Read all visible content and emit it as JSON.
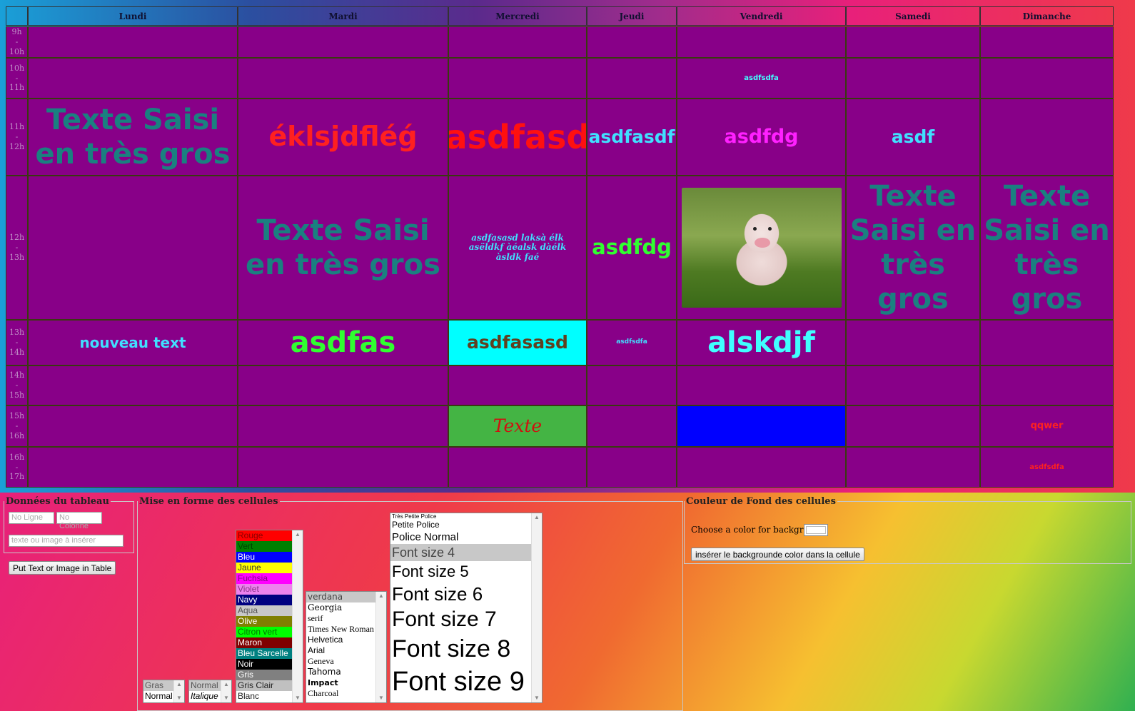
{
  "days": [
    "Lundi",
    "Mardi",
    "Mercredi",
    "Jeudi",
    "Vendredi",
    "Samedi",
    "Dimanche"
  ],
  "times": [
    [
      "9h",
      "-",
      "10h"
    ],
    [
      "10h",
      "-",
      "11h"
    ],
    [
      "11h",
      "-",
      "12h"
    ],
    [
      "12h",
      "-",
      "13h"
    ],
    [
      "13h",
      "-",
      "14h"
    ],
    [
      "14h",
      "-",
      "15h"
    ],
    [
      "15h",
      "-",
      "16h"
    ],
    [
      "16h",
      "-",
      "17h"
    ]
  ],
  "cells": {
    "r1_vendredi": "asdfsdfa",
    "r2_lundi": "Texte Saisi en très gros",
    "r2_mardi": "éklsjdfléǵ",
    "r2_mercredi": "asdfasd",
    "r2_jeudi": "asdfasdf",
    "r2_vendredi": "asdfdg",
    "r2_samedi": "asdf",
    "r3_mardi": "Texte Saisi en très gros",
    "r3_mercredi": "asdfasasd laksà élk asëldkf àéalsk dàélk àsldk faé",
    "r3_jeudi": "asdfdg",
    "r3_samedi": "Texte Saisi en très gros",
    "r3_dimanche": "Texte Saisi en très gros",
    "r4_lundi": "nouveau text",
    "r4_mardi": "asdfas",
    "r4_mercredi": "asdfasasd",
    "r4_jeudi": "asdfsdfa",
    "r4_vendredi": "alskdjf",
    "r6_mercredi": "Texte",
    "r6_dimanche": "qqwer",
    "r7_dimanche": "asdfsdfa"
  },
  "panels": {
    "data": {
      "legend": "Données du tableau",
      "row_placeholder": "No Ligne",
      "col_placeholder": "No Colonne",
      "text_placeholder": "texte ou image à insérer",
      "button": "Put Text or Image in Table"
    },
    "format": {
      "legend": "Mise en forme des cellules",
      "weight_options": [
        "Gras",
        "Normal"
      ],
      "style_options": [
        "Normal",
        "Italique"
      ],
      "colors": [
        {
          "label": "Rouge",
          "bg": "#ff0000",
          "fg": "#880000"
        },
        {
          "label": "Vert",
          "bg": "#008000",
          "fg": "#004400"
        },
        {
          "label": "Bleu",
          "bg": "#0000ff",
          "fg": "#ffffff"
        },
        {
          "label": "Jaune",
          "bg": "#ffff00",
          "fg": "#333333"
        },
        {
          "label": "Fuchsia",
          "bg": "#ff00ff",
          "fg": "#880088"
        },
        {
          "label": "Violet",
          "bg": "#ee82ee",
          "fg": "#883388"
        },
        {
          "label": "Navy",
          "bg": "#000080",
          "fg": "#ffffff"
        },
        {
          "label": "Aqua",
          "bg": "#c8c8c8",
          "fg": "#555555"
        },
        {
          "label": "Olive",
          "bg": "#808000",
          "fg": "#ffffff"
        },
        {
          "label": "Citron vert",
          "bg": "#00ff00",
          "fg": "#007700"
        },
        {
          "label": "Maron",
          "bg": "#800000",
          "fg": "#ffffff"
        },
        {
          "label": "Bleu Sarcelle",
          "bg": "#008080",
          "fg": "#ffffff"
        },
        {
          "label": "Noir",
          "bg": "#000000",
          "fg": "#ffffff"
        },
        {
          "label": "Gris",
          "bg": "#808080",
          "fg": "#ffffff"
        },
        {
          "label": "Gris Clair",
          "bg": "#c0c0c0",
          "fg": "#222222"
        },
        {
          "label": "Blanc",
          "bg": "#ffffff",
          "fg": "#222222"
        }
      ],
      "fonts": [
        "verdana",
        "Georgia",
        "serif",
        "Times New Roman",
        "Helvetica",
        "Arial",
        "Geneva",
        "Tahoma",
        "Impact",
        "Charcoal"
      ],
      "sizes": [
        "Très Petite Police",
        "Petite Police",
        "Police Normal",
        "Font size 4",
        "Font size 5",
        "Font size 6",
        "Font size 7",
        "Font size 8",
        "Font size 9"
      ]
    },
    "background": {
      "legend": "Couleur de Fond des cellules",
      "label": "Choose a color for background:",
      "button": "insérer le backgrounde color dans la cellule"
    }
  },
  "colors": {
    "cell_purple": "#880088",
    "teal_text": "#1a8080",
    "cyan_cell": "#00ffff",
    "green_cell": "#44b444",
    "blue_cell": "#0000ff"
  }
}
